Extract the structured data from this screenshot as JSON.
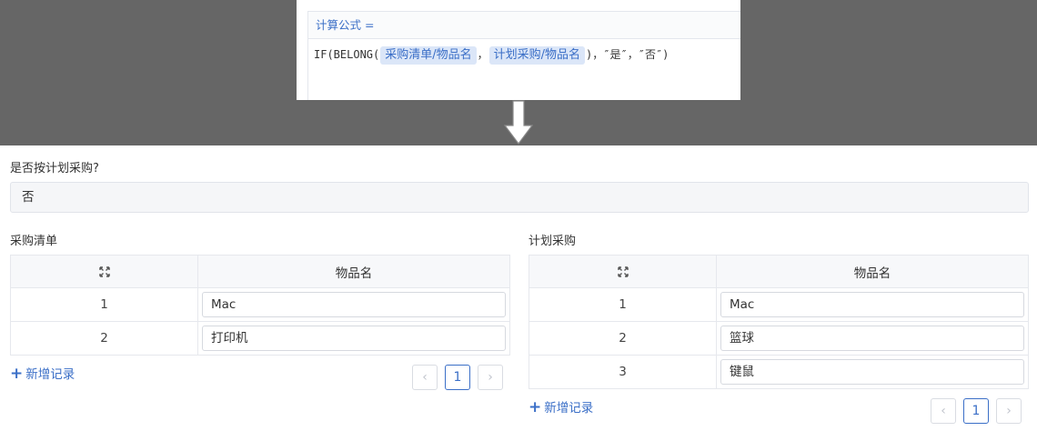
{
  "formula": {
    "header": "计算公式 =",
    "prefix": "IF(BELONG(",
    "chip1": "采购清单/物品名",
    "sep": "，",
    "chip2": "计划采购/物品名",
    "suffix": ")，″是″，″否″)"
  },
  "field": {
    "label": "是否按计划采购?",
    "value": "否"
  },
  "left_table": {
    "title": "采购清单",
    "column": "物品名",
    "rows": [
      {
        "index": "1",
        "name": "Mac"
      },
      {
        "index": "2",
        "name": "打印机"
      }
    ],
    "add_label": "新增记录",
    "page": "1"
  },
  "right_table": {
    "title": "计划采购",
    "column": "物品名",
    "rows": [
      {
        "index": "1",
        "name": "Mac"
      },
      {
        "index": "2",
        "name": "篮球"
      },
      {
        "index": "3",
        "name": "键鼠"
      }
    ],
    "add_label": "新增记录",
    "page": "1"
  },
  "colors": {
    "accent": "#3b6fc7",
    "banner": "#666666",
    "chip_bg": "#dbe6f8"
  }
}
